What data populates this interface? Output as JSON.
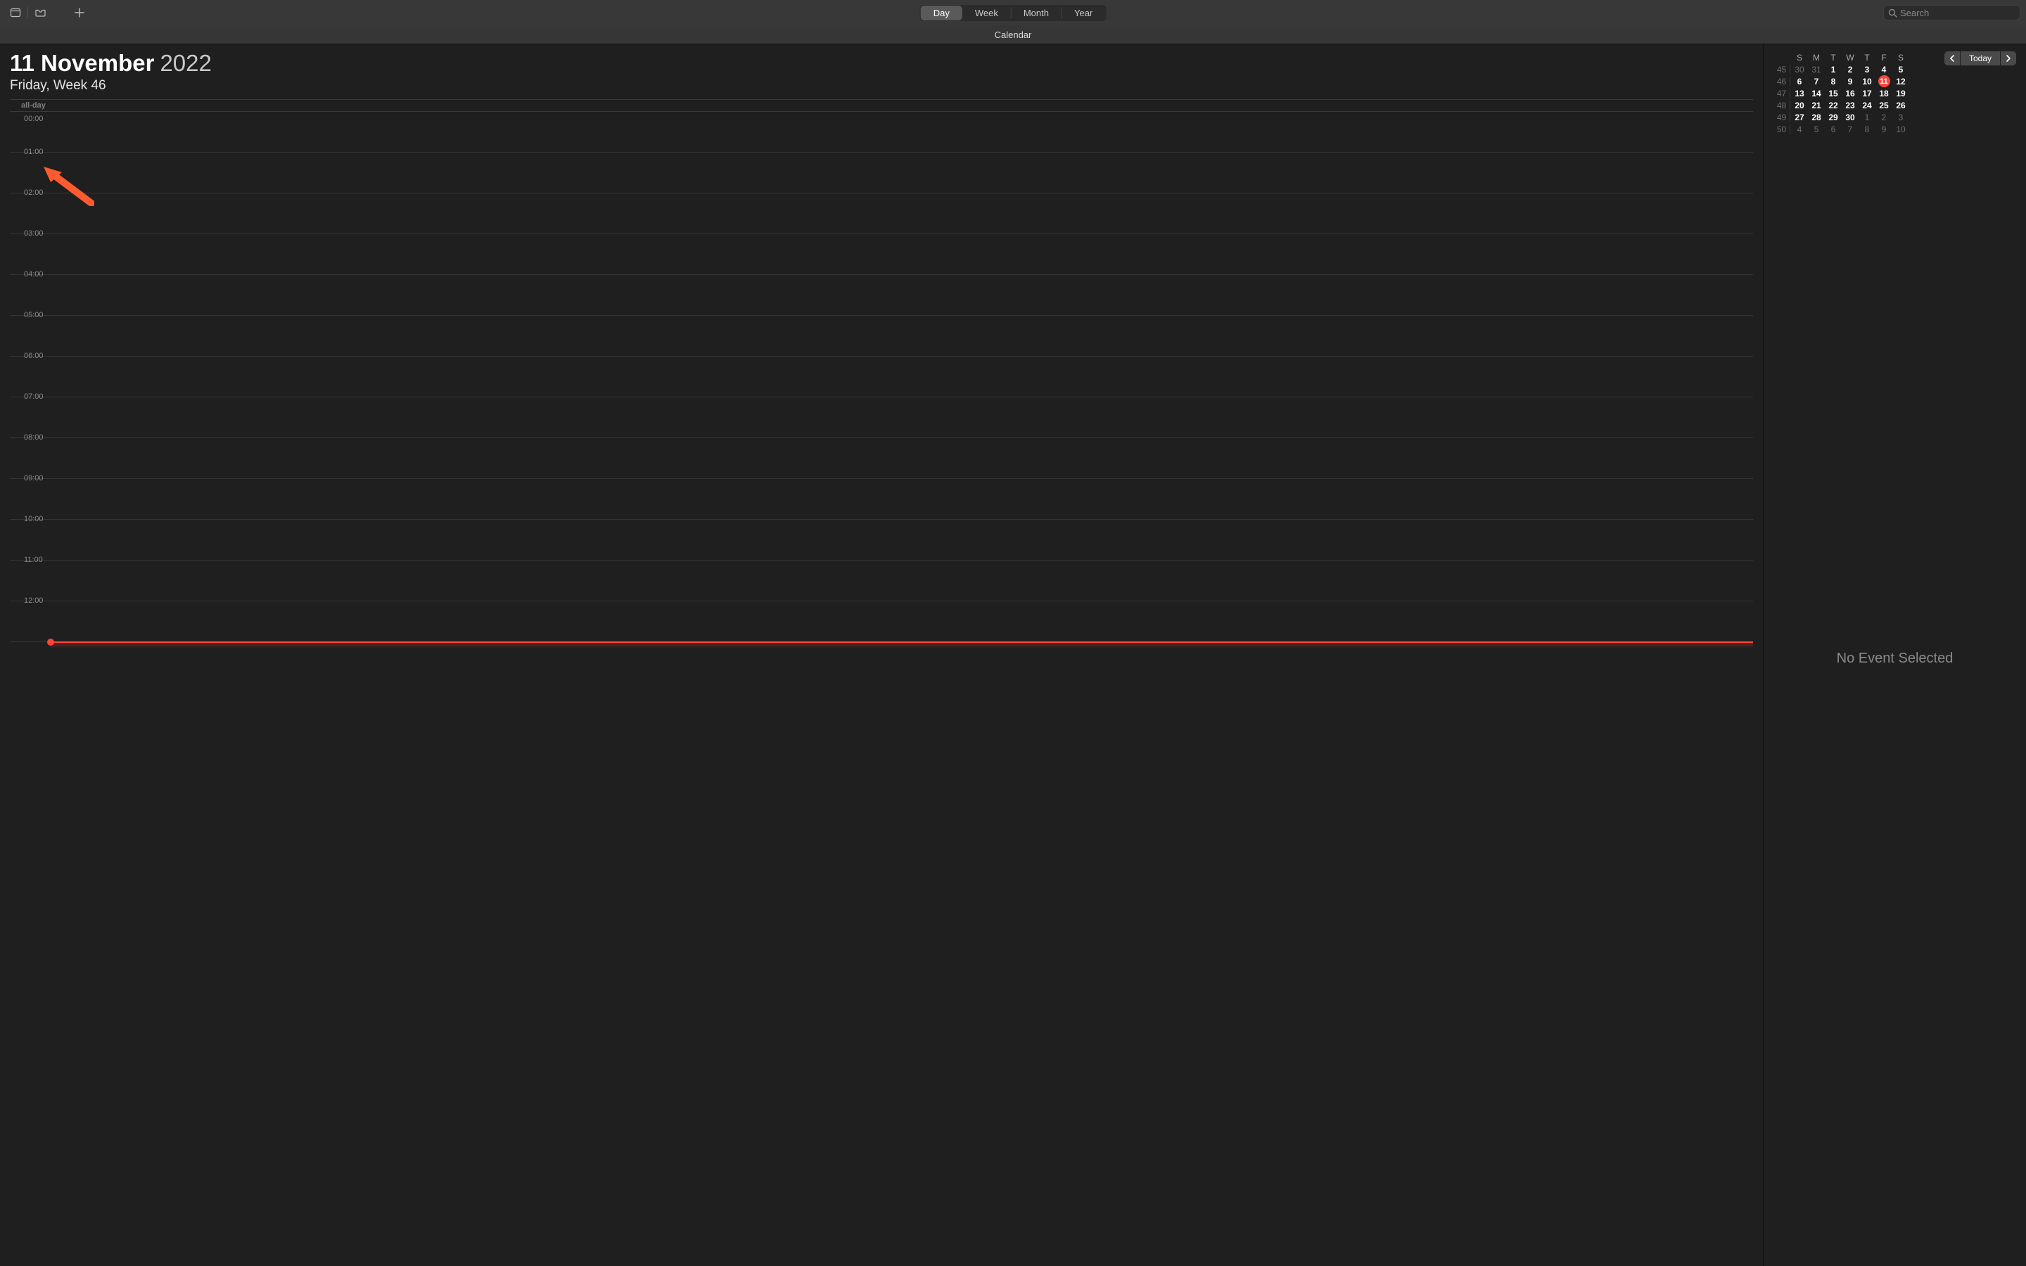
{
  "toolbar": {
    "view_options": [
      "Day",
      "Week",
      "Month",
      "Year"
    ],
    "active_view_index": 0,
    "search_placeholder": "Search"
  },
  "subheader": {
    "title": "Calendar"
  },
  "date_header": {
    "day_month": "11 November",
    "year": "2022",
    "subtitle": "Friday, Week 46"
  },
  "allday_label": "all-day",
  "hours": [
    "00:00",
    "01:00",
    "02:00",
    "03:00",
    "04:00",
    "05:00",
    "06:00",
    "07:00",
    "08:00",
    "09:00",
    "10:00",
    "11:00",
    "12:00"
  ],
  "mini_calendar": {
    "dow": [
      "S",
      "M",
      "T",
      "W",
      "T",
      "F",
      "S"
    ],
    "rows": [
      {
        "wk": "45",
        "days": [
          {
            "n": "30",
            "in": false
          },
          {
            "n": "31",
            "in": false
          },
          {
            "n": "1",
            "in": true
          },
          {
            "n": "2",
            "in": true
          },
          {
            "n": "3",
            "in": true
          },
          {
            "n": "4",
            "in": true
          },
          {
            "n": "5",
            "in": true
          }
        ]
      },
      {
        "wk": "46",
        "days": [
          {
            "n": "6",
            "in": true
          },
          {
            "n": "7",
            "in": true
          },
          {
            "n": "8",
            "in": true
          },
          {
            "n": "9",
            "in": true
          },
          {
            "n": "10",
            "in": true
          },
          {
            "n": "11",
            "in": true,
            "today": true
          },
          {
            "n": "12",
            "in": true
          }
        ]
      },
      {
        "wk": "47",
        "days": [
          {
            "n": "13",
            "in": true
          },
          {
            "n": "14",
            "in": true
          },
          {
            "n": "15",
            "in": true
          },
          {
            "n": "16",
            "in": true
          },
          {
            "n": "17",
            "in": true
          },
          {
            "n": "18",
            "in": true
          },
          {
            "n": "19",
            "in": true
          }
        ]
      },
      {
        "wk": "48",
        "days": [
          {
            "n": "20",
            "in": true
          },
          {
            "n": "21",
            "in": true
          },
          {
            "n": "22",
            "in": true
          },
          {
            "n": "23",
            "in": true
          },
          {
            "n": "24",
            "in": true
          },
          {
            "n": "25",
            "in": true
          },
          {
            "n": "26",
            "in": true
          }
        ]
      },
      {
        "wk": "49",
        "days": [
          {
            "n": "27",
            "in": true
          },
          {
            "n": "28",
            "in": true
          },
          {
            "n": "29",
            "in": true
          },
          {
            "n": "30",
            "in": true
          },
          {
            "n": "1",
            "in": false
          },
          {
            "n": "2",
            "in": false
          },
          {
            "n": "3",
            "in": false
          }
        ]
      },
      {
        "wk": "50",
        "days": [
          {
            "n": "4",
            "in": false
          },
          {
            "n": "5",
            "in": false
          },
          {
            "n": "6",
            "in": false
          },
          {
            "n": "7",
            "in": false
          },
          {
            "n": "8",
            "in": false
          },
          {
            "n": "9",
            "in": false
          },
          {
            "n": "10",
            "in": false
          }
        ]
      }
    ]
  },
  "nav": {
    "today_label": "Today"
  },
  "sidebar": {
    "no_event_text": "No Event Selected"
  }
}
